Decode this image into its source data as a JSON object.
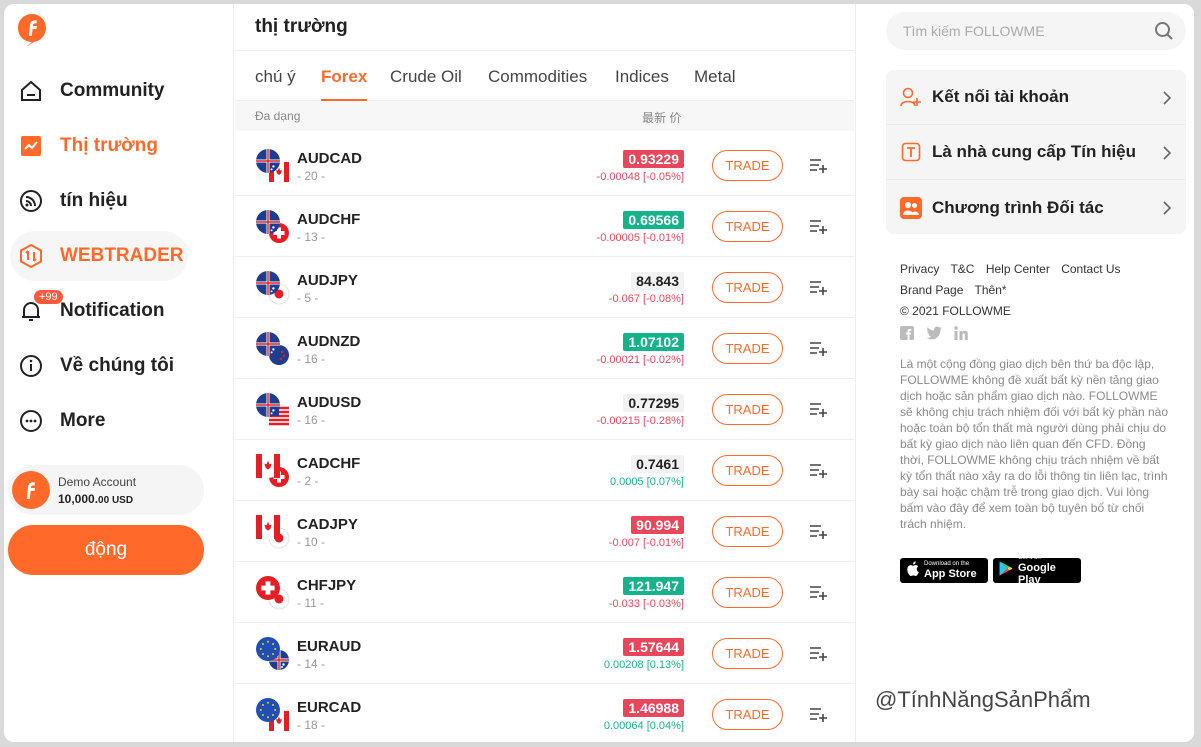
{
  "sidebar": {
    "items": [
      {
        "label": "Community",
        "icon": "home-icon"
      },
      {
        "label": "Thị trường",
        "icon": "market-chart-icon"
      },
      {
        "label": "tín hiệu",
        "icon": "signal-icon"
      },
      {
        "label": "WEBTRADER",
        "icon": "webtrader-icon"
      },
      {
        "label": "Notification",
        "icon": "bell-icon",
        "badge": "+99"
      },
      {
        "label": "Về chúng tôi",
        "icon": "info-icon"
      },
      {
        "label": "More",
        "icon": "more-dots-icon"
      }
    ],
    "demo": {
      "name": "Demo Account",
      "balance": "10,000.",
      "balance_small": "00 USD"
    },
    "action_button": "động"
  },
  "market": {
    "title": "thị trường",
    "tabs": [
      "chú ý",
      "Forex",
      "Crude Oil",
      "Commodities",
      "Indices",
      "Metal"
    ],
    "active_tab": "Forex",
    "header": {
      "symbol": "Đa dạng",
      "price": "最新 价"
    },
    "trade_label": "TRADE",
    "rows": [
      {
        "symbol": "AUDCAD",
        "count": "- 20 -",
        "price": "0.93229",
        "dir": "dn",
        "change": "-0.00048 [-0.05%]",
        "chg": "neg",
        "flags": [
          "au",
          "ca"
        ]
      },
      {
        "symbol": "AUDCHF",
        "count": "- 13 -",
        "price": "0.69566",
        "dir": "up",
        "change": "-0.00005 [-0.01%]",
        "chg": "neg",
        "flags": [
          "au",
          "ch"
        ]
      },
      {
        "symbol": "AUDJPY",
        "count": "- 5 -",
        "price": "84.843",
        "dir": "nt",
        "change": "-0.067 [-0.08%]",
        "chg": "neg",
        "flags": [
          "au",
          "jp"
        ]
      },
      {
        "symbol": "AUDNZD",
        "count": "- 16 -",
        "price": "1.07102",
        "dir": "up",
        "change": "-0.00021 [-0.02%]",
        "chg": "neg",
        "flags": [
          "au",
          "nz"
        ]
      },
      {
        "symbol": "AUDUSD",
        "count": "- 16 -",
        "price": "0.77295",
        "dir": "nt",
        "change": "-0.00215 [-0.28%]",
        "chg": "neg",
        "flags": [
          "au",
          "us"
        ]
      },
      {
        "symbol": "CADCHF",
        "count": "- 2 -",
        "price": "0.7461",
        "dir": "nt",
        "change": "0.0005 [0.07%]",
        "chg": "pos",
        "flags": [
          "ca",
          "ch"
        ]
      },
      {
        "symbol": "CADJPY",
        "count": "- 10 -",
        "price": "90.994",
        "dir": "dn",
        "change": "-0.007 [-0.01%]",
        "chg": "neg",
        "flags": [
          "ca",
          "jp"
        ]
      },
      {
        "symbol": "CHFJPY",
        "count": "- 11 -",
        "price": "121.947",
        "dir": "up",
        "change": "-0.033 [-0.03%]",
        "chg": "neg",
        "flags": [
          "ch",
          "jp"
        ]
      },
      {
        "symbol": "EURAUD",
        "count": "- 14 -",
        "price": "1.57644",
        "dir": "dn",
        "change": "0.00208 [0.13%]",
        "chg": "pos",
        "flags": [
          "eu",
          "au"
        ]
      },
      {
        "symbol": "EURCAD",
        "count": "- 18 -",
        "price": "1.46988",
        "dir": "dn",
        "change": "0.00064 [0.04%]",
        "chg": "pos",
        "flags": [
          "eu",
          "ca"
        ]
      }
    ]
  },
  "right": {
    "search_placeholder": "Tìm kiếm FOLLOWME",
    "menu": [
      {
        "label": "Kết nối tài khoản",
        "icon": "add-user-icon"
      },
      {
        "label": "Là nhà cung cấp Tín hiệu",
        "icon": "signal-provider-icon"
      },
      {
        "label": "Chương trình Đối tác",
        "icon": "partner-icon"
      }
    ],
    "links": [
      "Privacy",
      "T&C",
      "Help Center",
      "Contact Us",
      "Brand Page",
      "Thên*"
    ],
    "copyright": "© 2021 FOLLOWME",
    "disclaimer": "Là một cộng đồng giao dịch bên thứ ba độc lập, FOLLOWME không đề xuất bất kỳ nền tảng giao dịch hoặc sản phẩm giao dịch nào. FOLLOWME sẽ không chịu trách nhiệm đối với bất kỳ phần nào hoặc toàn bộ tổn thất mà người dùng phải chịu do bất kỳ giao dịch nào liên quan đến CFD. Đồng thời, FOLLOWME không chịu trách nhiệm về bất kỳ tổn thất nào xảy ra do lỗi thông tin liên lạc, trình bày sai hoặc chậm trễ trong giao dịch. Vui lòng bấm vào đây để xem toàn bộ tuyên bố từ chối trách nhiệm.",
    "appstore": {
      "small": "Download on the",
      "big": "App Store"
    },
    "googleplay": {
      "small": "Get it on",
      "big": "Google Play"
    }
  },
  "watermark": "@TínhNăngSảnPhẩm",
  "colors": {
    "accent": "#ff6a2b",
    "up": "#14b38a",
    "down": "#e8475b"
  }
}
